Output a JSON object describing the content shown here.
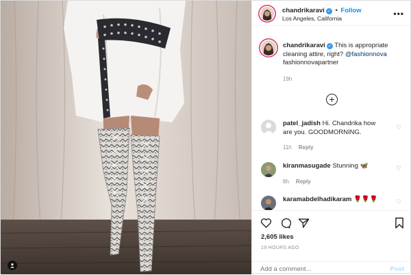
{
  "photo": {
    "alt_icon": "person-tag-icon"
  },
  "header": {
    "username": "chandrikaravi",
    "follow_separator": "•",
    "follow_label": "Follow",
    "location": "Los Angeles, California",
    "more_label": "•••"
  },
  "caption": {
    "username": "chandrikaravi",
    "text": "This is appropriate cleaning attire, right?",
    "mention": "@fashionnova",
    "partner": "fashionnovapartner",
    "time": "19h"
  },
  "load_more": {
    "label": "+"
  },
  "comments": [
    {
      "username": "patel_jadish",
      "text": "Hi. Chandrika how are you. GOODMORNING.",
      "time": "11h",
      "reply": "Reply"
    },
    {
      "username": "kiranmasugade",
      "text": "Stunning",
      "emoji": "🦋",
      "time": "8h",
      "reply": "Reply"
    },
    {
      "username": "karamabdelhadikaram",
      "emoji": "🌹🌹🌹"
    }
  ],
  "actions": {
    "likes": "2,605 likes",
    "post_time": "19 HOURS AGO",
    "add_comment_placeholder": "Add a comment...",
    "post_label": "Post"
  },
  "colors": {
    "accent": "#0095f6",
    "verified": "#3897f0",
    "story_ring": "#e1306c",
    "post_disabled": "#b2dffc",
    "secondary_text": "#8e8e8e"
  }
}
